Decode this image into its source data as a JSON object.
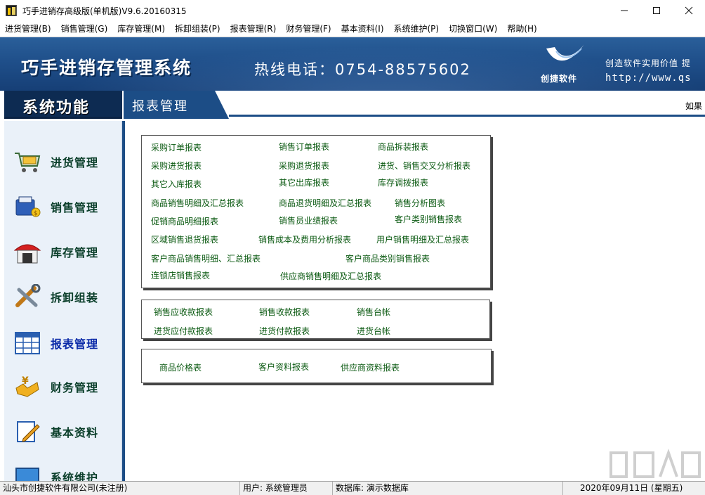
{
  "window": {
    "title": "巧手进销存高级版(单机版)V9.6.20160315",
    "minimize_icon": "minimize-icon",
    "maximize_icon": "maximize-icon",
    "close_icon": "close-icon"
  },
  "menu": [
    "进货管理(B)",
    "销售管理(G)",
    "库存管理(M)",
    "拆卸组装(P)",
    "报表管理(R)",
    "财务管理(F)",
    "基本资料(I)",
    "系统维护(P)",
    "切换窗口(W)",
    "帮助(H)"
  ],
  "banner": {
    "title": "巧手进销存管理系统",
    "phone": "热线电话：0754-88575602",
    "logo_text": "创捷软件",
    "slogan": "创造软件实用价值  提",
    "website": "http://www.qs"
  },
  "header": {
    "section_title": "系统功能",
    "current_module": "报表管理",
    "hint": "如果"
  },
  "sidebar": {
    "items": [
      {
        "label": "进货管理",
        "icon": "shopping-cart-icon"
      },
      {
        "label": "销售管理",
        "icon": "cash-register-icon"
      },
      {
        "label": "库存管理",
        "icon": "warehouse-icon"
      },
      {
        "label": "拆卸组装",
        "icon": "tools-icon"
      },
      {
        "label": "报表管理",
        "icon": "report-table-icon"
      },
      {
        "label": "财务管理",
        "icon": "finance-icon"
      },
      {
        "label": "基本资料",
        "icon": "edit-document-icon"
      },
      {
        "label": "系统维护",
        "icon": "monitor-icon"
      }
    ]
  },
  "reports": {
    "group1": [
      "采购订单报表",
      "销售订单报表",
      "商品拆装报表",
      "采购进货报表",
      "采购退货报表",
      "进货、销售交叉分析报表",
      "其它入库报表",
      "其它出库报表",
      "库存调拨报表",
      "商品销售明细及汇总报表",
      "商品退货明细及汇总报表",
      "销售分析图表",
      "促销商品明细报表",
      "销售员业绩报表",
      "客户类别销售报表",
      "区域销售退货报表",
      "销售成本及费用分析报表",
      "用户销售明细及汇总报表",
      "客户商品销售明细、汇总报表",
      "客户商品类别销售报表",
      "连锁店销售报表",
      "供应商销售明细及汇总报表"
    ],
    "group2": [
      "销售应收款报表",
      "销售收款报表",
      "销售台帐",
      "进货应付款报表",
      "进货付款报表",
      "进货台帐"
    ],
    "group3": [
      "商品价格表",
      "客户资料报表",
      "供应商资料报表"
    ]
  },
  "status": {
    "company": "汕头市创捷软件有限公司(未注册)",
    "user": "用户: 系统管理员",
    "database": "数据库: 演示数据库",
    "date": "2020年09月11日  (星期五)"
  }
}
